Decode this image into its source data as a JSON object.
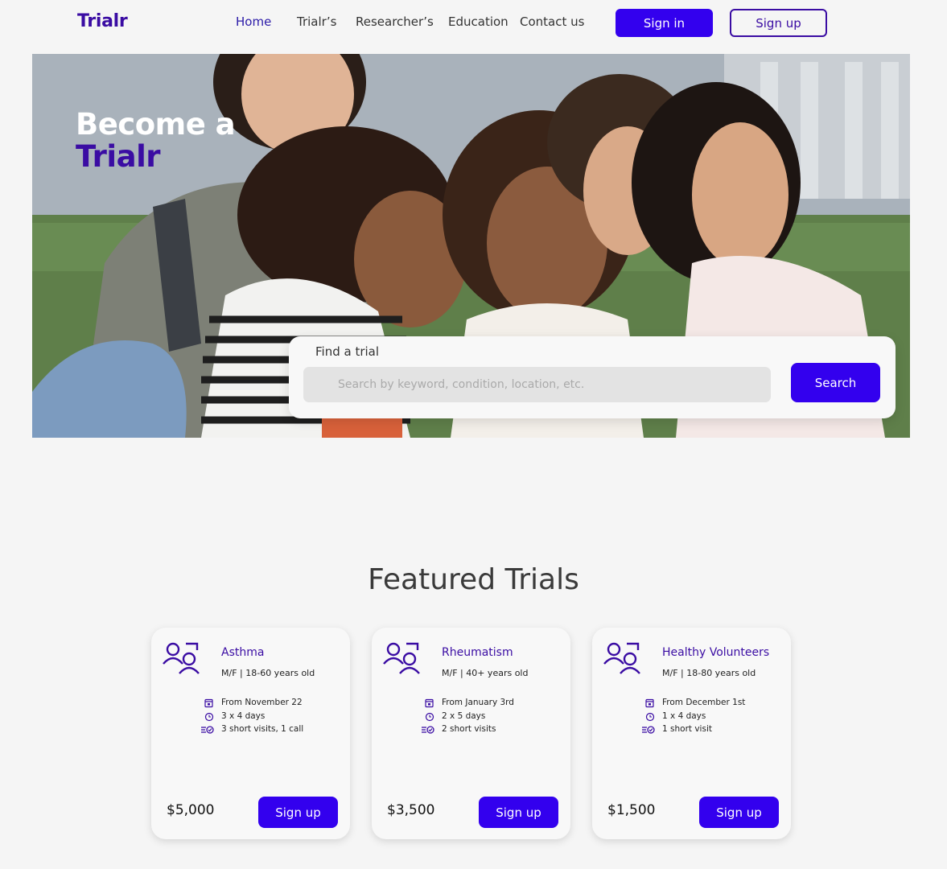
{
  "brand": {
    "logo": "Trialr"
  },
  "nav": {
    "items": [
      {
        "label": "Home",
        "active": true
      },
      {
        "label": "Trialr’s"
      },
      {
        "label": "Researcher’s"
      },
      {
        "label": "Education"
      },
      {
        "label": "Contact us"
      }
    ],
    "signin_label": "Sign in",
    "signup_label": "Sign up"
  },
  "hero": {
    "title_line1": "Become a",
    "title_line2": "Trialr"
  },
  "search": {
    "label": "Find a trial",
    "placeholder": "Search by keyword, condition, location, etc.",
    "button_label": "Search"
  },
  "featured": {
    "title": "Featured Trials",
    "cards": [
      {
        "title": "Asthma",
        "subtitle": "M/F | 18-60 years old",
        "date": "From November 22",
        "duration": "3 x 4 days",
        "visits": "3 short visits, 1 call",
        "price": "$5,000",
        "button_label": "Sign up"
      },
      {
        "title": "Rheumatism",
        "subtitle": "M/F | 40+ years old",
        "date": "From January 3rd",
        "duration": "2 x 5 days",
        "visits": "2 short visits",
        "price": "$3,500",
        "button_label": "Sign up"
      },
      {
        "title": "Healthy Volunteers",
        "subtitle": "M/F | 18-80 years old",
        "date": "From December 1st",
        "duration": "1 x 4 days",
        "visits": "1 short visit",
        "price": "$1,500",
        "button_label": "Sign up"
      }
    ]
  },
  "colors": {
    "brand_primary": "#3300ee",
    "brand_dark": "#3a0ca3",
    "background": "#f5f5f5"
  }
}
